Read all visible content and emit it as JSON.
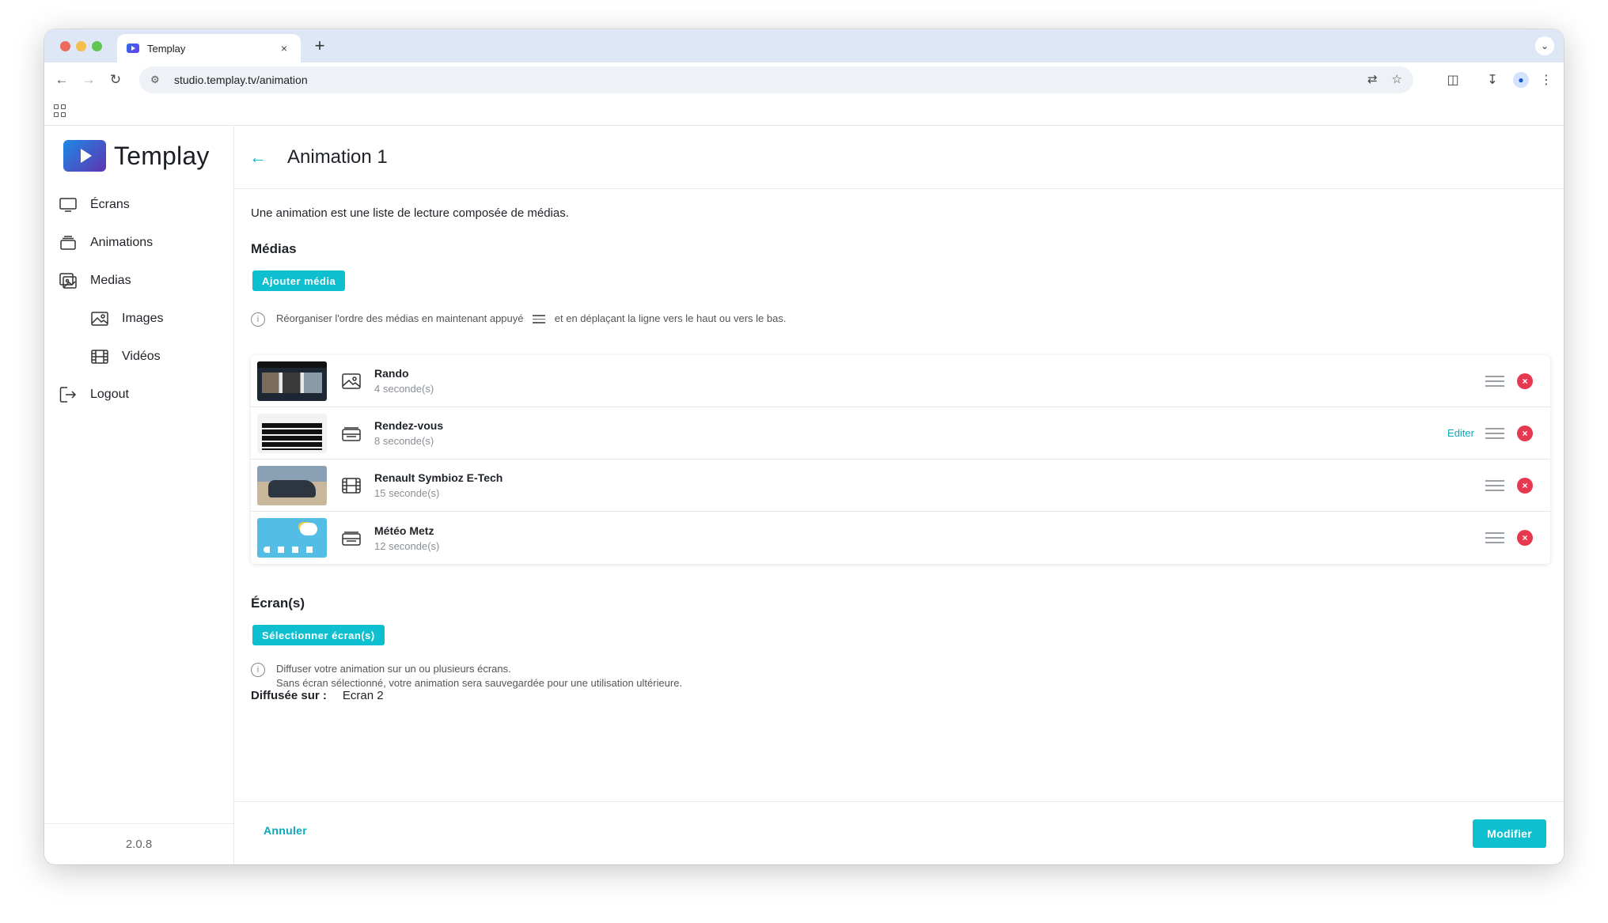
{
  "browser": {
    "tab_title": "Templay",
    "tab_close": "×",
    "new_tab": "+",
    "url": "studio.templay.tv/animation"
  },
  "app": {
    "logo_text": "Templay",
    "version": "2.0.8"
  },
  "sidebar": {
    "items": [
      {
        "label": "Écrans",
        "icon": "monitor-icon"
      },
      {
        "label": "Animations",
        "icon": "stack-icon"
      },
      {
        "label": "Medias",
        "icon": "gallery-icon"
      },
      {
        "label": "Images",
        "icon": "image-icon"
      },
      {
        "label": "Vidéos",
        "icon": "film-icon"
      },
      {
        "label": "Logout",
        "icon": "logout-icon"
      }
    ]
  },
  "header": {
    "back": "←",
    "title": "Animation 1"
  },
  "intro": "Une animation est une liste de lecture composée de médias.",
  "medias": {
    "title": "Médias",
    "add_button": "Ajouter média",
    "hint_before": "Réorganiser l'ordre des médias en maintenant appuyé",
    "hint_after": "et en déplaçant la ligne vers le haut ou vers le bas.",
    "items": [
      {
        "name": "Rando",
        "duration": "4 seconde(s)",
        "type_icon": "image-icon",
        "edit": ""
      },
      {
        "name": "Rendez-vous",
        "duration": "8 seconde(s)",
        "type_icon": "template-icon",
        "edit": "Editer"
      },
      {
        "name": "Renault Symbioz E-Tech",
        "duration": "15 seconde(s)",
        "type_icon": "film-icon",
        "edit": ""
      },
      {
        "name": "Météo Metz",
        "duration": "12 seconde(s)",
        "type_icon": "template-icon",
        "edit": ""
      }
    ]
  },
  "screens": {
    "title": "Écran(s)",
    "select_button": "Sélectionner écran(s)",
    "hint_line1": "Diffuser votre animation sur un ou plusieurs écrans.",
    "hint_line2": "Sans écran sélectionné, votre animation sera sauvegardée pour une utilisation ultérieure.",
    "broadcast_label": "Diffusée sur :",
    "broadcast_value": "Ecran 2"
  },
  "footer": {
    "cancel": "Annuler",
    "save": "Modifier"
  },
  "colors": {
    "accent": "#0ec0cf",
    "danger": "#e6384e"
  }
}
